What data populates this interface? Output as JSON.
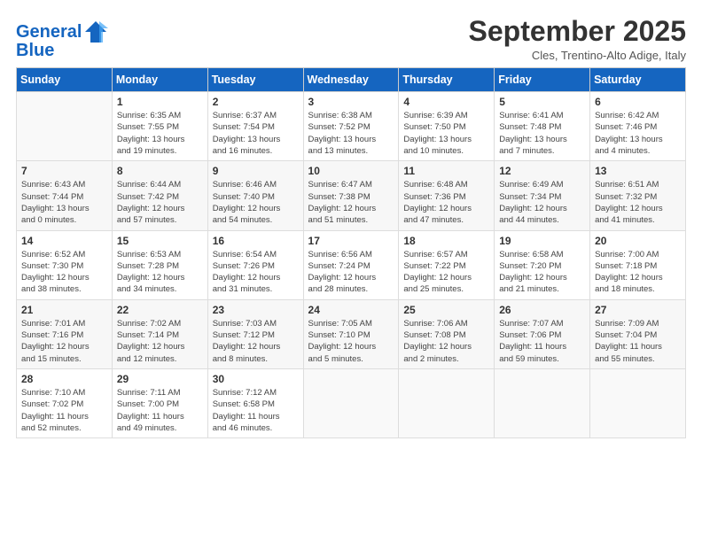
{
  "logo": {
    "line1": "General",
    "line2": "Blue"
  },
  "title": "September 2025",
  "subtitle": "Cles, Trentino-Alto Adige, Italy",
  "days_of_week": [
    "Sunday",
    "Monday",
    "Tuesday",
    "Wednesday",
    "Thursday",
    "Friday",
    "Saturday"
  ],
  "weeks": [
    [
      {
        "num": "",
        "detail": ""
      },
      {
        "num": "1",
        "detail": "Sunrise: 6:35 AM\nSunset: 7:55 PM\nDaylight: 13 hours\nand 19 minutes."
      },
      {
        "num": "2",
        "detail": "Sunrise: 6:37 AM\nSunset: 7:54 PM\nDaylight: 13 hours\nand 16 minutes."
      },
      {
        "num": "3",
        "detail": "Sunrise: 6:38 AM\nSunset: 7:52 PM\nDaylight: 13 hours\nand 13 minutes."
      },
      {
        "num": "4",
        "detail": "Sunrise: 6:39 AM\nSunset: 7:50 PM\nDaylight: 13 hours\nand 10 minutes."
      },
      {
        "num": "5",
        "detail": "Sunrise: 6:41 AM\nSunset: 7:48 PM\nDaylight: 13 hours\nand 7 minutes."
      },
      {
        "num": "6",
        "detail": "Sunrise: 6:42 AM\nSunset: 7:46 PM\nDaylight: 13 hours\nand 4 minutes."
      }
    ],
    [
      {
        "num": "7",
        "detail": "Sunrise: 6:43 AM\nSunset: 7:44 PM\nDaylight: 13 hours\nand 0 minutes."
      },
      {
        "num": "8",
        "detail": "Sunrise: 6:44 AM\nSunset: 7:42 PM\nDaylight: 12 hours\nand 57 minutes."
      },
      {
        "num": "9",
        "detail": "Sunrise: 6:46 AM\nSunset: 7:40 PM\nDaylight: 12 hours\nand 54 minutes."
      },
      {
        "num": "10",
        "detail": "Sunrise: 6:47 AM\nSunset: 7:38 PM\nDaylight: 12 hours\nand 51 minutes."
      },
      {
        "num": "11",
        "detail": "Sunrise: 6:48 AM\nSunset: 7:36 PM\nDaylight: 12 hours\nand 47 minutes."
      },
      {
        "num": "12",
        "detail": "Sunrise: 6:49 AM\nSunset: 7:34 PM\nDaylight: 12 hours\nand 44 minutes."
      },
      {
        "num": "13",
        "detail": "Sunrise: 6:51 AM\nSunset: 7:32 PM\nDaylight: 12 hours\nand 41 minutes."
      }
    ],
    [
      {
        "num": "14",
        "detail": "Sunrise: 6:52 AM\nSunset: 7:30 PM\nDaylight: 12 hours\nand 38 minutes."
      },
      {
        "num": "15",
        "detail": "Sunrise: 6:53 AM\nSunset: 7:28 PM\nDaylight: 12 hours\nand 34 minutes."
      },
      {
        "num": "16",
        "detail": "Sunrise: 6:54 AM\nSunset: 7:26 PM\nDaylight: 12 hours\nand 31 minutes."
      },
      {
        "num": "17",
        "detail": "Sunrise: 6:56 AM\nSunset: 7:24 PM\nDaylight: 12 hours\nand 28 minutes."
      },
      {
        "num": "18",
        "detail": "Sunrise: 6:57 AM\nSunset: 7:22 PM\nDaylight: 12 hours\nand 25 minutes."
      },
      {
        "num": "19",
        "detail": "Sunrise: 6:58 AM\nSunset: 7:20 PM\nDaylight: 12 hours\nand 21 minutes."
      },
      {
        "num": "20",
        "detail": "Sunrise: 7:00 AM\nSunset: 7:18 PM\nDaylight: 12 hours\nand 18 minutes."
      }
    ],
    [
      {
        "num": "21",
        "detail": "Sunrise: 7:01 AM\nSunset: 7:16 PM\nDaylight: 12 hours\nand 15 minutes."
      },
      {
        "num": "22",
        "detail": "Sunrise: 7:02 AM\nSunset: 7:14 PM\nDaylight: 12 hours\nand 12 minutes."
      },
      {
        "num": "23",
        "detail": "Sunrise: 7:03 AM\nSunset: 7:12 PM\nDaylight: 12 hours\nand 8 minutes."
      },
      {
        "num": "24",
        "detail": "Sunrise: 7:05 AM\nSunset: 7:10 PM\nDaylight: 12 hours\nand 5 minutes."
      },
      {
        "num": "25",
        "detail": "Sunrise: 7:06 AM\nSunset: 7:08 PM\nDaylight: 12 hours\nand 2 minutes."
      },
      {
        "num": "26",
        "detail": "Sunrise: 7:07 AM\nSunset: 7:06 PM\nDaylight: 11 hours\nand 59 minutes."
      },
      {
        "num": "27",
        "detail": "Sunrise: 7:09 AM\nSunset: 7:04 PM\nDaylight: 11 hours\nand 55 minutes."
      }
    ],
    [
      {
        "num": "28",
        "detail": "Sunrise: 7:10 AM\nSunset: 7:02 PM\nDaylight: 11 hours\nand 52 minutes."
      },
      {
        "num": "29",
        "detail": "Sunrise: 7:11 AM\nSunset: 7:00 PM\nDaylight: 11 hours\nand 49 minutes."
      },
      {
        "num": "30",
        "detail": "Sunrise: 7:12 AM\nSunset: 6:58 PM\nDaylight: 11 hours\nand 46 minutes."
      },
      {
        "num": "",
        "detail": ""
      },
      {
        "num": "",
        "detail": ""
      },
      {
        "num": "",
        "detail": ""
      },
      {
        "num": "",
        "detail": ""
      }
    ]
  ]
}
